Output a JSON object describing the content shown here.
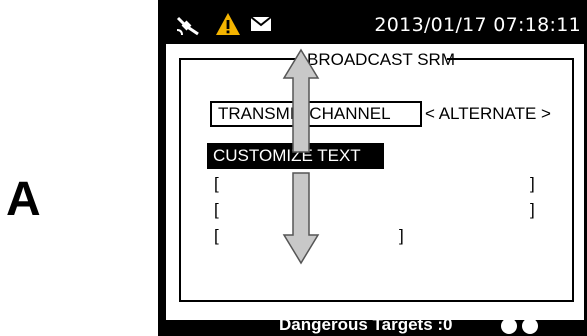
{
  "figure": {
    "step_letter": "A"
  },
  "status_bar": {
    "icons": [
      "satellite-icon",
      "warning-icon",
      "envelope-icon"
    ],
    "colors": {
      "warning": "#f4b400",
      "background": "#000000",
      "text": "#ffffff"
    },
    "datetime": "2013/01/17 07:18:11"
  },
  "screen": {
    "title": "BROADCAST SRM",
    "field_label": "TRANSMIT CHANNEL",
    "field_value": "< ALTERNATE >",
    "section_header": "CUSTOMIZE TEXT",
    "text_lines": [
      {
        "open": "[",
        "close": "]"
      },
      {
        "open": "[",
        "close": "]"
      },
      {
        "open": "[",
        "close": "]"
      }
    ],
    "scroll_arrows": [
      "arrow-up-icon",
      "arrow-down-icon"
    ]
  },
  "bottom_bar": {
    "label": "Dangerous Targets :0",
    "indicators": 2
  }
}
